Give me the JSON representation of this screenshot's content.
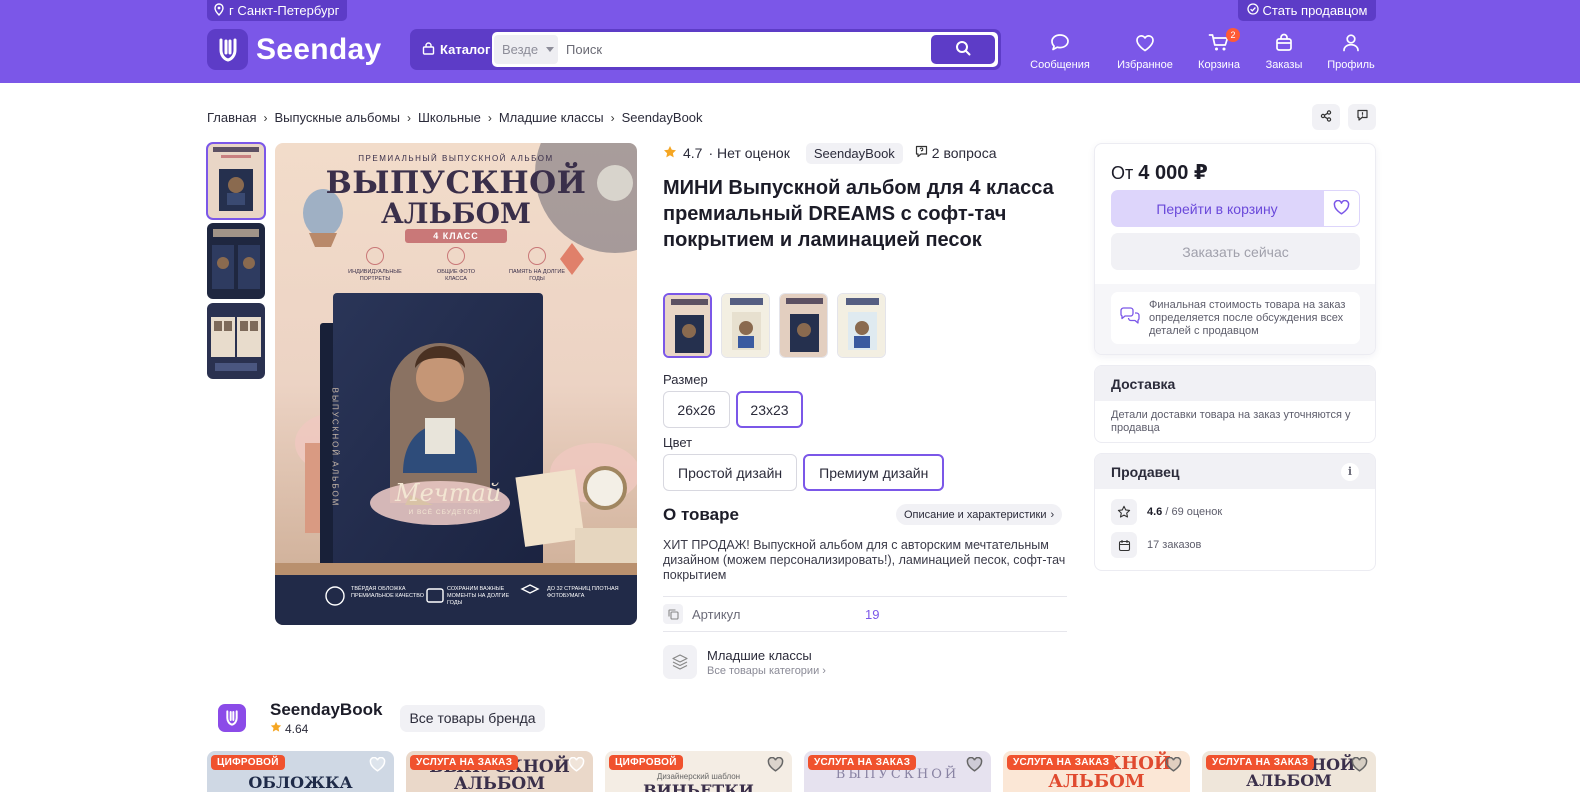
{
  "header": {
    "city": "г Санкт-Петербург",
    "become_seller": "Стать продавцом",
    "logo_text": "Seenday",
    "catalog_label": "Каталог",
    "search_scope": "Везде",
    "search_placeholder": "Поиск",
    "nav": [
      {
        "label": "Сообщения",
        "icon": "chat-icon"
      },
      {
        "label": "Избранное",
        "icon": "heart-icon"
      },
      {
        "label": "Корзина",
        "icon": "cart-icon",
        "badge": "2"
      },
      {
        "label": "Заказы",
        "icon": "bag-icon"
      },
      {
        "label": "Профиль",
        "icon": "user-icon"
      }
    ]
  },
  "breadcrumb": [
    "Главная",
    "Выпускные альбомы",
    "Школьные",
    "Младшие классы",
    "SeendayBook"
  ],
  "gallery": {
    "cover_top": "ПРЕМИАЛЬНЫЙ ВЫПУСКНОЙ АЛЬБОМ",
    "cover_title_1": "ВЫПУСКНОЙ",
    "cover_title_2": "АЛЬБОМ",
    "cover_class": "4 КЛАСС",
    "cover_features": [
      "ИНДИВИДУАЛЬНЫЕ ПОРТРЕТЫ",
      "ОБЩИЕ ФОТО КЛАССА",
      "ПАМЯТЬ НА ДОЛГИЕ ГОДЫ"
    ],
    "book_script": "Мечтай",
    "book_sub": "И ВСЁ СБУДЕТСЯ!",
    "book_spine": "ВЫПУСКНОЙ АЛЬБОМ",
    "bottom_features": [
      "ТВЁРДАЯ ОБЛОЖКА ПРЕМИАЛЬНОЕ КАЧЕСТВО",
      "СОХРАНИМ ВАЖНЫЕ МОМЕНТЫ НА ДОЛГИЕ ГОДЫ",
      "ДО 32 СТРАНИЦ ПЛОТНАЯ ФОТОБУМАГА"
    ]
  },
  "product": {
    "rating": "4.7",
    "reviews": "· Нет оценок",
    "brand": "SeendayBook",
    "questions": "2 вопроса",
    "title": "МИНИ Выпускной альбом для 4 класса премиальный DREAMS с софт-тач покрытием и ламинацией песок",
    "size_label": "Размер",
    "sizes": [
      "26x26",
      "23x23"
    ],
    "color_label": "Цвет",
    "colors": [
      "Простой дизайн",
      "Премиум дизайн"
    ],
    "about_title": "О товаре",
    "about_link": "Описание и характеристики",
    "about_text": "ХИТ ПРОДАЖ! Выпускной альбом для с авторским мечтательным дизайном (можем персонализировать!), ламинацией песок, софт-тач покрытием",
    "article_label": "Артикул",
    "article_value": "19",
    "category_name": "Младшие классы",
    "category_all": "Все товары категории"
  },
  "purchase": {
    "price_prefix": "От",
    "price": "4 000 ₽",
    "cart_button": "Перейти в корзину",
    "order_button": "Заказать сейчас",
    "note": "Финальная стоимость товара на заказ определяется после обсуждения всех деталей с продавцом"
  },
  "delivery": {
    "title": "Доставка",
    "text": "Детали доставки товара на заказ уточняются у продавца"
  },
  "seller": {
    "title": "Продавец",
    "rating": "4.6",
    "rating_rest": "/ 69 оценок",
    "orders": "17 заказов"
  },
  "brand_strip": {
    "name": "SeendayBook",
    "rating": "4.64",
    "all_button": "Все товары бренда"
  },
  "cards": [
    {
      "tag": "ЦИФРОВОЙ",
      "title": "ОБЛОЖКА"
    },
    {
      "tag": "УСЛУГА НА ЗАКАЗ",
      "title": "ВЫПУСКНОЙ АЛЬБОМ"
    },
    {
      "tag": "ЦИФРОВОЙ",
      "title": "ВИНЬЕТКИ",
      "sub": "Дизайнерский шаблон"
    },
    {
      "tag": "УСЛУГА НА ЗАКАЗ",
      "title": "ВЫПУСКНОЙ"
    },
    {
      "tag": "УСЛУГА НА ЗАКАЗ",
      "title": "ВЫПУСКНОЙ АЛЬБОМ"
    },
    {
      "tag": "УСЛУГА НА ЗАКАЗ",
      "title": "ВЫПУСКНОЙ АЛЬБОМ"
    }
  ],
  "colors": {
    "brand": "#7b57e8",
    "brand_dark": "#5d3cc7",
    "tag": "#f0522e",
    "star": "#f5a623"
  }
}
